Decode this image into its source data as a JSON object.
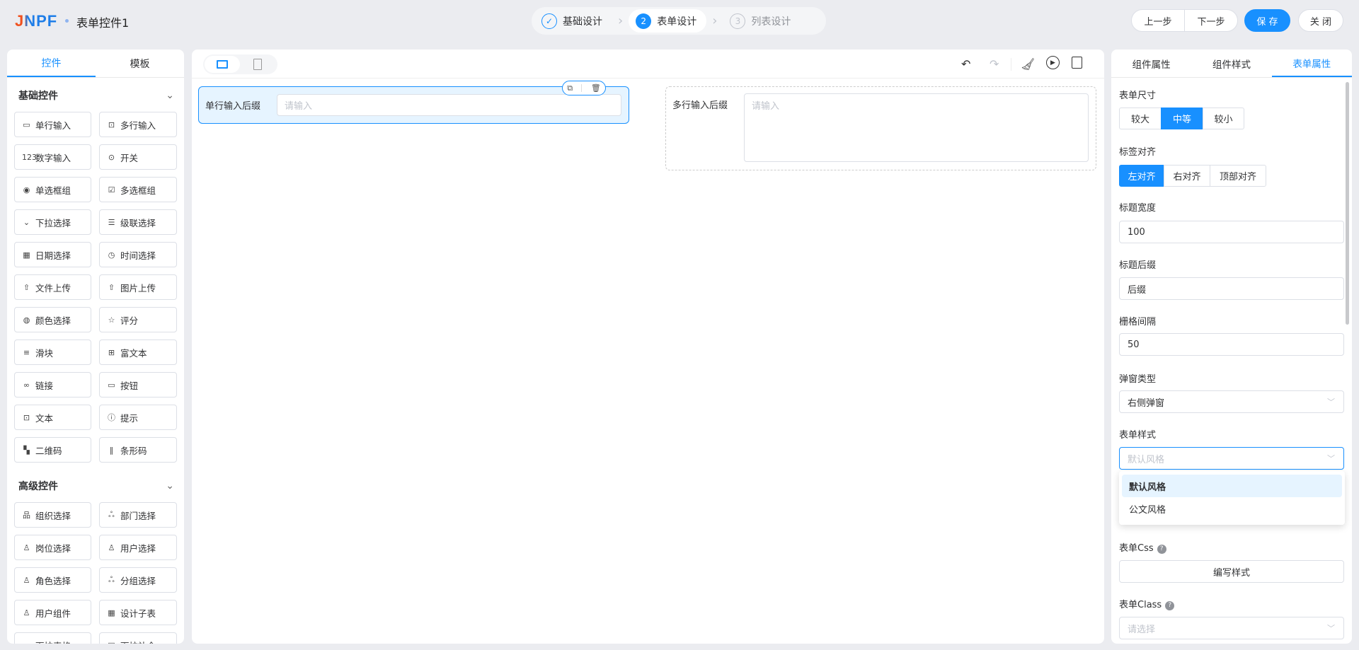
{
  "header": {
    "logo": "JNPF",
    "title": "表单控件1",
    "steps": [
      {
        "num": "✓",
        "label": "基础设计",
        "state": "done"
      },
      {
        "num": "2",
        "label": "表单设计",
        "state": "active"
      },
      {
        "num": "3",
        "label": "列表设计",
        "state": "future"
      }
    ],
    "buttons": {
      "prev": "上一步",
      "next": "下一步",
      "save": "保 存",
      "close": "关 闭"
    }
  },
  "left": {
    "tabs": [
      "控件",
      "模板"
    ],
    "basic_title": "基础控件",
    "basic": [
      {
        "icon": "▭",
        "label": "单行输入"
      },
      {
        "icon": "⊡",
        "label": "多行输入"
      },
      {
        "icon": "123",
        "label": "数字输入"
      },
      {
        "icon": "⊙",
        "label": "开关"
      },
      {
        "icon": "◉",
        "label": "单选框组"
      },
      {
        "icon": "☑",
        "label": "多选框组"
      },
      {
        "icon": "⌄",
        "label": "下拉选择"
      },
      {
        "icon": "☰",
        "label": "级联选择"
      },
      {
        "icon": "▦",
        "label": "日期选择"
      },
      {
        "icon": "◷",
        "label": "时间选择"
      },
      {
        "icon": "⇧",
        "label": "文件上传"
      },
      {
        "icon": "⇧",
        "label": "图片上传"
      },
      {
        "icon": "◍",
        "label": "颜色选择"
      },
      {
        "icon": "☆",
        "label": "评分"
      },
      {
        "icon": "≡",
        "label": "滑块"
      },
      {
        "icon": "⊞",
        "label": "富文本"
      },
      {
        "icon": "∞",
        "label": "链接"
      },
      {
        "icon": "▭",
        "label": "按钮"
      },
      {
        "icon": "⊡",
        "label": "文本"
      },
      {
        "icon": "ⓘ",
        "label": "提示"
      },
      {
        "icon": "▚",
        "label": "二维码"
      },
      {
        "icon": "‖",
        "label": "条形码"
      }
    ],
    "advanced_title": "高级控件",
    "advanced": [
      {
        "icon": "品",
        "label": "组织选择"
      },
      {
        "icon": "ஃ",
        "label": "部门选择"
      },
      {
        "icon": "♙",
        "label": "岗位选择"
      },
      {
        "icon": "♙",
        "label": "用户选择"
      },
      {
        "icon": "♙",
        "label": "角色选择"
      },
      {
        "icon": "ஃ",
        "label": "分组选择"
      },
      {
        "icon": "♙",
        "label": "用户组件"
      },
      {
        "icon": "▦",
        "label": "设计子表"
      },
      {
        "icon": "ı",
        "label": "下拉表格"
      },
      {
        "icon": "▤",
        "label": "下拉补全"
      }
    ]
  },
  "canvas": {
    "field1": {
      "label": "单行输入后缀",
      "placeholder": "请输入"
    },
    "field2": {
      "label": "多行输入后缀",
      "placeholder": "请输入"
    }
  },
  "right": {
    "tabs": [
      "组件属性",
      "组件样式",
      "表单属性"
    ],
    "size_label": "表单尺寸",
    "sizes": [
      "较大",
      "中等",
      "较小"
    ],
    "align_label": "标签对齐",
    "aligns": [
      "左对齐",
      "右对齐",
      "顶部对齐"
    ],
    "width_label": "标题宽度",
    "width_value": "100",
    "suffix_label": "标题后缀",
    "suffix_value": "后缀",
    "gutter_label": "栅格间隔",
    "gutter_value": "50",
    "popup_label": "弹窗类型",
    "popup_value": "右侧弹窗",
    "style_label": "表单样式",
    "style_placeholder": "默认风格",
    "style_options": [
      "默认风格",
      "公文风格"
    ],
    "css_label": "表单Css",
    "css_button": "编写样式",
    "class_label": "表单Class",
    "class_placeholder": "请选择"
  },
  "colors": {
    "primary": "#1890ff",
    "background": "#ebecf0"
  }
}
